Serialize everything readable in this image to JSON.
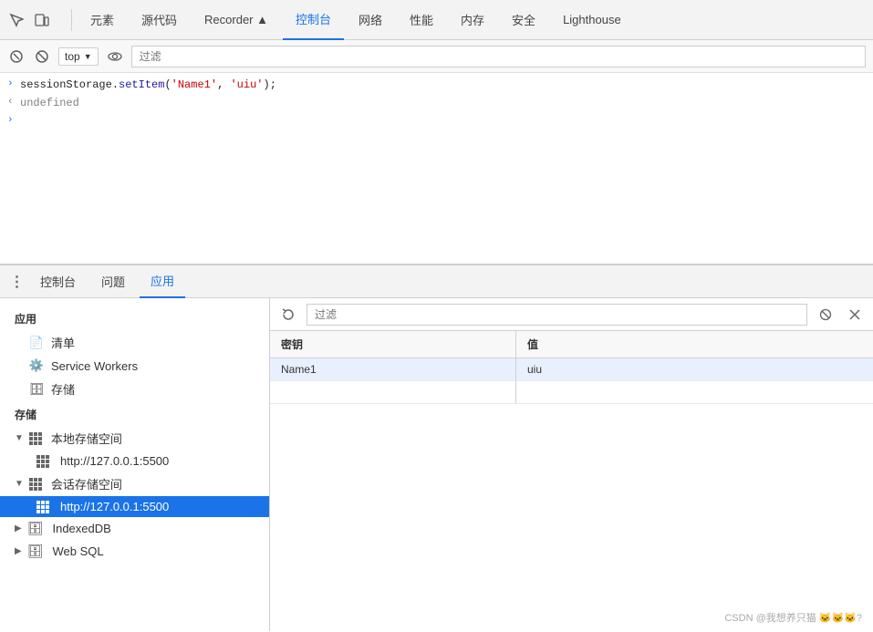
{
  "topNav": {
    "tabs": [
      {
        "label": "元素",
        "active": false
      },
      {
        "label": "源代码",
        "active": false
      },
      {
        "label": "Recorder ▲",
        "active": false
      },
      {
        "label": "控制台",
        "active": true
      },
      {
        "label": "网络",
        "active": false
      },
      {
        "label": "性能",
        "active": false
      },
      {
        "label": "内存",
        "active": false
      },
      {
        "label": "安全",
        "active": false
      },
      {
        "label": "Lighthouse",
        "active": false
      }
    ]
  },
  "consoleToolbar": {
    "topContextLabel": "top",
    "filterPlaceholder": "过滤"
  },
  "consoleLines": [
    {
      "arrow": ">",
      "arrowColor": "blue",
      "content": "sessionStorage.setItem('Name1', 'uiu');"
    },
    {
      "arrow": "<",
      "arrowColor": "gray",
      "content": "undefined",
      "type": "undefined"
    },
    {
      "arrow": ">",
      "arrowColor": "blue",
      "content": ""
    }
  ],
  "bottomPanel": {
    "tabs": [
      {
        "label": "控制台",
        "active": false
      },
      {
        "label": "问题",
        "active": false
      },
      {
        "label": "应用",
        "active": true
      }
    ]
  },
  "sidebar": {
    "appSection": "应用",
    "appItems": [
      {
        "label": "清单",
        "icon": "file"
      },
      {
        "label": "Service Workers",
        "icon": "gear"
      },
      {
        "label": "存储",
        "icon": "db"
      }
    ],
    "storageSection": "存储",
    "storageItems": [
      {
        "label": "本地存储空间",
        "icon": "grid",
        "expanded": true,
        "children": [
          {
            "label": "http://127.0.0.1:5500",
            "icon": "grid",
            "selected": false
          }
        ]
      },
      {
        "label": "会话存储空间",
        "icon": "grid",
        "expanded": true,
        "children": [
          {
            "label": "http://127.0.0.1:5500",
            "icon": "grid",
            "selected": true
          }
        ]
      },
      {
        "label": "IndexedDB",
        "icon": "db",
        "expanded": false
      },
      {
        "label": "Web SQL",
        "icon": "db",
        "expanded": false
      }
    ]
  },
  "mainPanel": {
    "filterPlaceholder": "过滤",
    "tableHeaders": [
      "密钥",
      "值"
    ],
    "tableRows": [
      {
        "key": "Name1",
        "value": "uiu",
        "highlighted": true
      }
    ]
  },
  "watermark": "CSDN @我想养只猫 🐱🐱🐱?"
}
